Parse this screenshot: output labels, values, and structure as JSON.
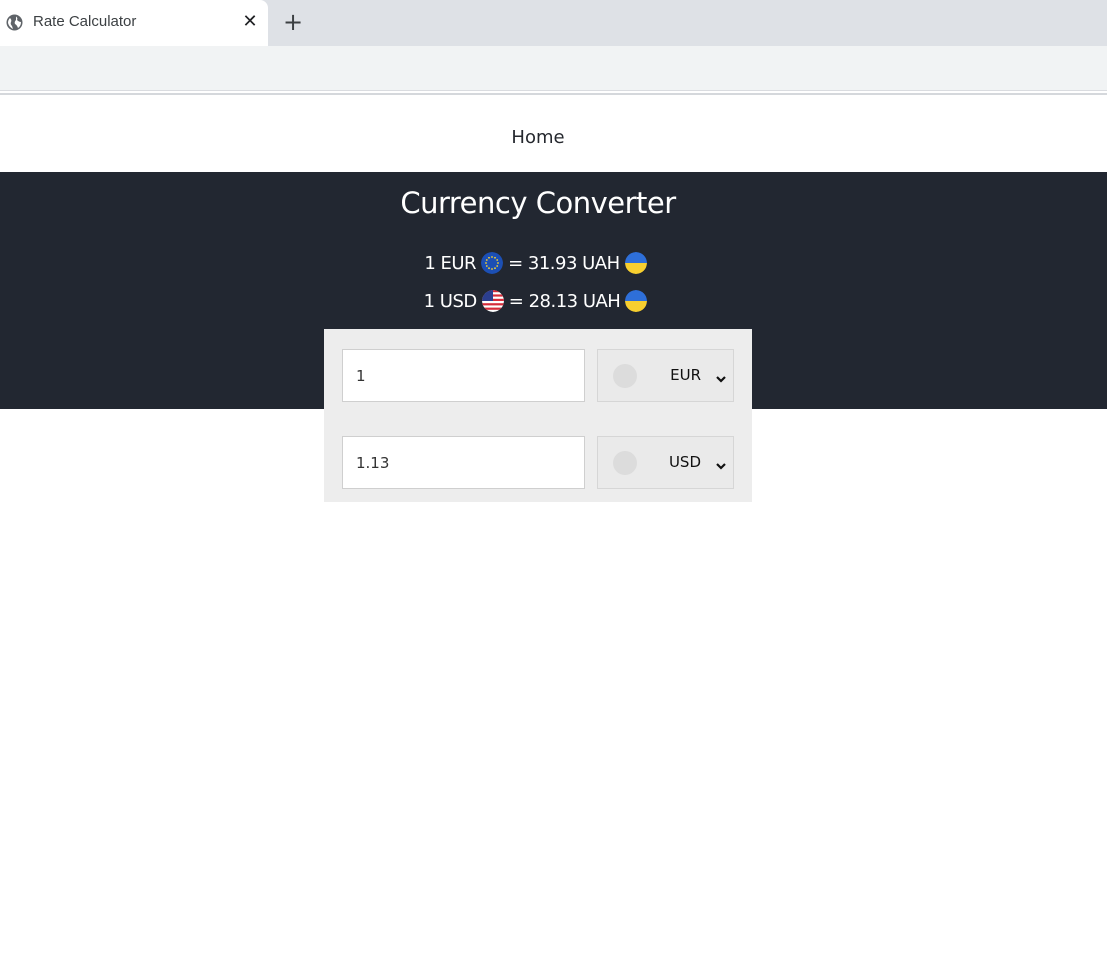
{
  "browser": {
    "tab_title": "Rate Calculator",
    "tab_icon": "globe-icon",
    "close_icon": "close-icon",
    "new_tab_icon": "plus-icon"
  },
  "nav": {
    "home_label": "Home"
  },
  "hero": {
    "title": "Currency Converter",
    "rates": [
      {
        "base": "1 EUR",
        "base_flag": "eu-flag-icon",
        "quote": "= 31.93 UAH",
        "quote_flag": "ua-flag-icon"
      },
      {
        "base": "1 USD",
        "base_flag": "us-flag-icon",
        "quote": "= 28.13 UAH",
        "quote_flag": "ua-flag-icon"
      }
    ]
  },
  "converter": {
    "rows": [
      {
        "amount": "1",
        "currency": "EUR"
      },
      {
        "amount": "1.13",
        "currency": "USD"
      }
    ]
  },
  "colors": {
    "hero_bg": "#222731",
    "panel_bg": "#ededed",
    "tabstrip_bg": "#dee1e6",
    "ua_blue": "#2e6fd9",
    "ua_yellow": "#f7cf2f",
    "eu_blue": "#1c4fb4"
  }
}
